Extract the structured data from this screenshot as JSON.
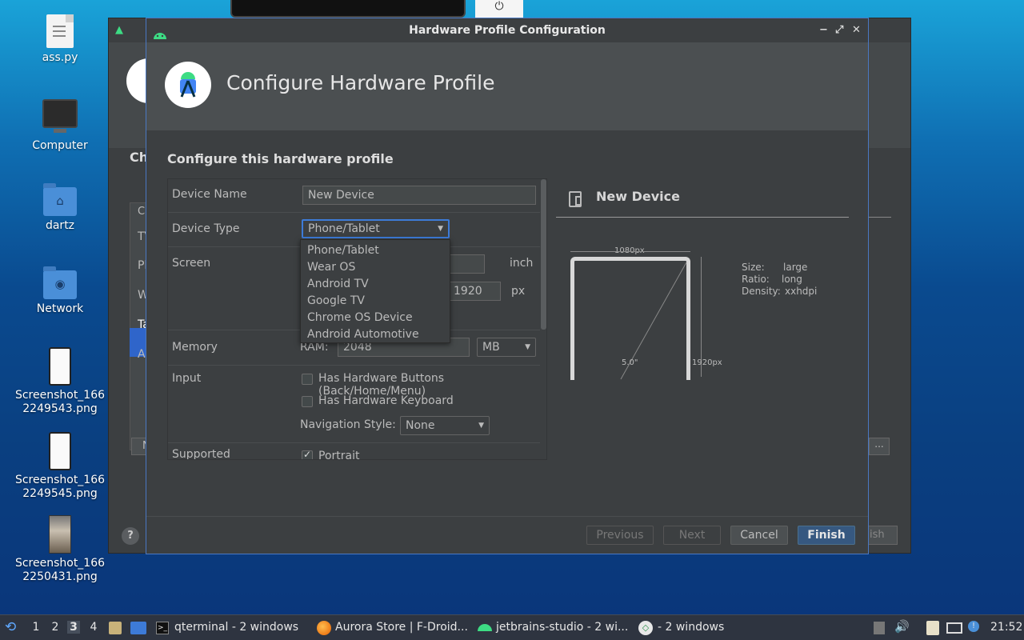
{
  "desktop": {
    "icons": [
      {
        "label": "ass.py"
      },
      {
        "label": "Computer"
      },
      {
        "label": "dartz",
        "symbol": "⌂"
      },
      {
        "label": "Network",
        "symbol": "◉"
      },
      {
        "label": "Screenshot_166\n2249543.png"
      },
      {
        "label": "Screenshot_166\n2249545.png"
      },
      {
        "label": "Screenshot_166\n2250431.png"
      }
    ]
  },
  "background_window": {
    "title_fragment": "Ch",
    "rows": [
      "Ca",
      "TV",
      "Ph",
      "W",
      "Ta",
      "A"
    ],
    "help_label": "?",
    "more_label": "...",
    "finish_fragment": "ish",
    "left_button_fragment": "N"
  },
  "dialog": {
    "window_title": "Hardware Profile Configuration",
    "controls": {
      "minimize": "−",
      "maximize": "⤢",
      "close": "✕"
    },
    "header_title": "Configure Hardware Profile",
    "section_title": "Configure this hardware profile",
    "form": {
      "device_name_label": "Device Name",
      "device_name_value": "New Device",
      "device_type_label": "Device Type",
      "device_type_value": "Phone/Tablet",
      "screen_label": "Screen",
      "screen_size_unit": "inch",
      "resolution_height": "1920",
      "resolution_unit": "px",
      "memory_label": "Memory",
      "ram_label": "RAM:",
      "ram_value": "2048",
      "ram_unit": "MB",
      "input_label": "Input",
      "hw_buttons_label": "Has Hardware Buttons (Back/Home/Menu)",
      "hw_keyboard_label": "Has Hardware Keyboard",
      "nav_style_label": "Navigation Style:",
      "nav_style_value": "None",
      "supported_label": "Supported",
      "portrait_label": "Portrait"
    },
    "device_type_options": [
      "Phone/Tablet",
      "Wear OS",
      "Android TV",
      "Google TV",
      "Chrome OS Device",
      "Android Automotive"
    ],
    "preview": {
      "name": "New Device",
      "width_label": "1080px",
      "height_label": "1920px",
      "diagonal_label": "5.0\"",
      "size_key": "Size:",
      "size_value": "large",
      "ratio_key": "Ratio:",
      "ratio_value": "long",
      "density_key": "Density:",
      "density_value": "xxhdpi"
    },
    "buttons": {
      "previous": "Previous",
      "next": "Next",
      "cancel": "Cancel",
      "finish": "Finish"
    }
  },
  "taskbar": {
    "workspaces": [
      "1",
      "2",
      "3",
      "4"
    ],
    "current_workspace": "3",
    "tasks": [
      {
        "label": "qterminal - 2 windows"
      },
      {
        "label": "Aurora Store | F-Droid..."
      },
      {
        "label": "jetbrains-studio - 2 wi..."
      },
      {
        "label": "- 2 windows"
      }
    ],
    "clock": "21:52"
  },
  "colors": {
    "accent": "#365880",
    "focus_border": "#3d7bd8",
    "android_green": "#3ddc84",
    "dialog_bg": "#3c3f41"
  }
}
